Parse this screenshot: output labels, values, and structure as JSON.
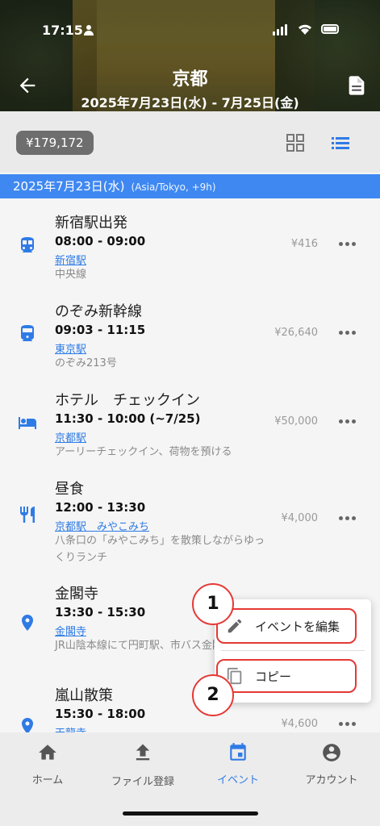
{
  "status_bar": {
    "time": "17:15"
  },
  "header": {
    "title": "京都",
    "subtitle": "2025年7月23日(水) - 7月25日(金)"
  },
  "toolbar": {
    "total": "¥179,172",
    "active_view": "list"
  },
  "date_header": {
    "date": "2025年7月23日(水)",
    "timezone": "(Asia/Tokyo, +9h)"
  },
  "events": [
    {
      "icon": "train-icon",
      "name": "新宿駅出発",
      "time": "08:00 - 09:00",
      "place": "新宿駅",
      "note": "中央線",
      "cost": "¥416"
    },
    {
      "icon": "shinkansen-icon",
      "name": "のぞみ新幹線",
      "time": "09:03 - 11:15",
      "place": "東京駅",
      "note": "のぞみ213号",
      "cost": "¥26,640"
    },
    {
      "icon": "hotel-icon",
      "name": "ホテル　チェックイン",
      "time": "11:30 - 10:00 (~7/25)",
      "place": "京都駅",
      "note": "アーリーチェックイン、荷物を預ける",
      "cost": "¥50,000"
    },
    {
      "icon": "restaurant-icon",
      "name": "昼食",
      "time": "12:00 - 13:30",
      "place": "京都駅　みやこみち",
      "note": "八条口の「みやこみち」を散策しながらゆっくりランチ",
      "cost": "¥4,000"
    },
    {
      "icon": "location-pin-icon",
      "name": "金閣寺",
      "time": "13:30 - 15:30",
      "place": "金閣寺",
      "note": "JR山陰本線にて円町駅、市バス金閣寺まで",
      "cost": ""
    },
    {
      "icon": "location-pin-icon",
      "name": "嵐山散策",
      "time": "15:30 - 18:00",
      "place": "天龍寺",
      "note": "",
      "cost": "¥4,600"
    }
  ],
  "context_menu": {
    "items": [
      {
        "icon": "pencil-icon",
        "label": "イベントを編集"
      },
      {
        "icon": "copy-icon",
        "label": "コピー"
      }
    ],
    "annotations": [
      "1",
      "2"
    ]
  },
  "bottom_nav": {
    "items": [
      {
        "icon": "home-icon",
        "label": "ホーム"
      },
      {
        "icon": "upload-icon",
        "label": "ファイル登録"
      },
      {
        "icon": "calendar-icon",
        "label": "イベント"
      },
      {
        "icon": "account-icon",
        "label": "アカウント"
      }
    ],
    "active": "イベント"
  },
  "colors": {
    "accent": "#3f88f2",
    "annotation": "#e53935",
    "chip": "#6e6e6e"
  }
}
